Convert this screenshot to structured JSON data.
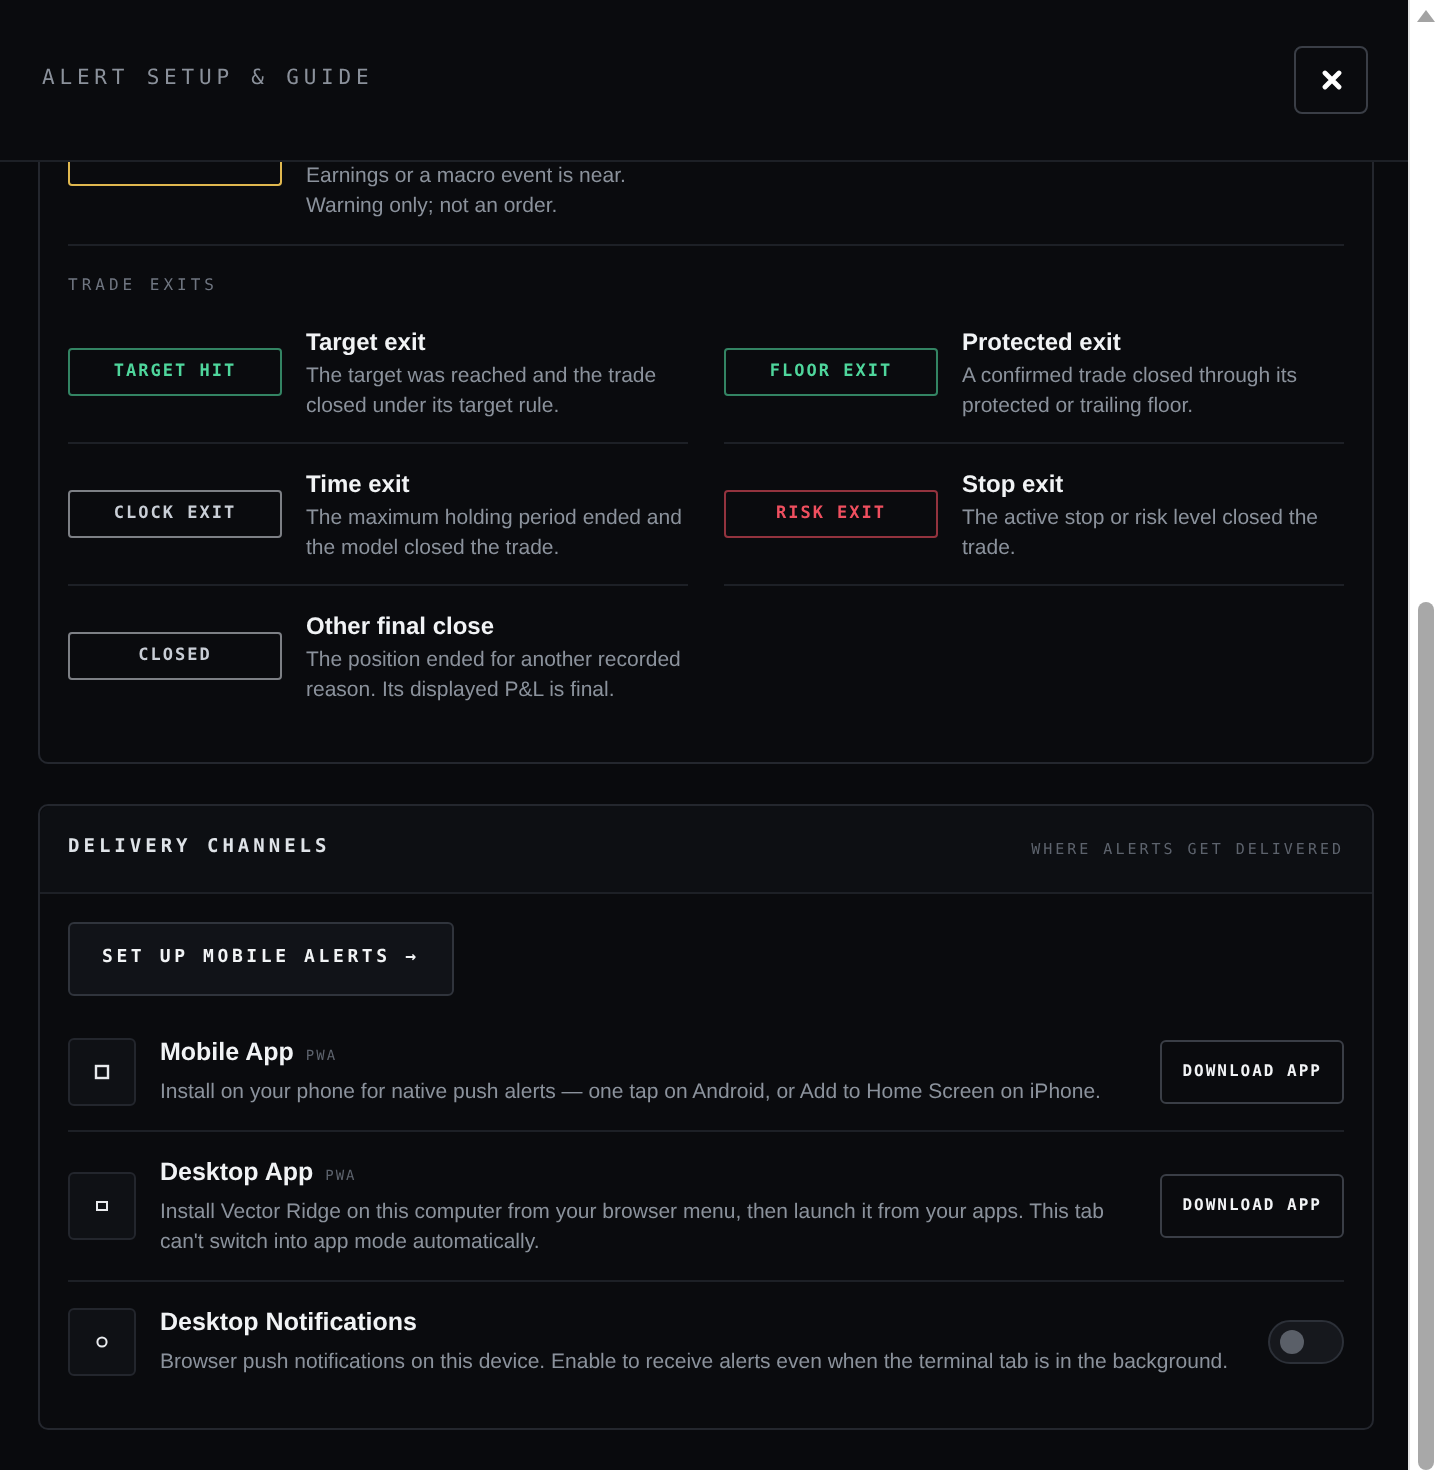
{
  "header": {
    "title": "ALERT SETUP & GUIDE"
  },
  "guide": {
    "partial_row": {
      "color": "#e0b84f",
      "lines": [
        "Earnings or a macro event is near.",
        "Warning only; not an order."
      ]
    },
    "section_label": "TRADE EXITS",
    "exits": [
      {
        "badge": "TARGET HIT",
        "color": "#4fd69c",
        "title": "Target exit",
        "description": "The target was reached and the trade closed under its target rule."
      },
      {
        "badge": "FLOOR EXIT",
        "color": "#4fd69c",
        "title": "Protected exit",
        "description": "A confirmed trade closed through its protected or trailing floor."
      },
      {
        "badge": "CLOCK EXIT",
        "color": "#c9ced6",
        "title": "Time exit",
        "description": "The maximum holding period ended and the model closed the trade."
      },
      {
        "badge": "RISK EXIT",
        "color": "#ef4f5f",
        "title": "Stop exit",
        "description": "The active stop or risk level closed the trade."
      },
      {
        "badge": "CLOSED",
        "color": "#c9ced6",
        "title": "Other final close",
        "description": "The position ended for another recorded reason. Its displayed P&L is final."
      }
    ]
  },
  "delivery": {
    "title": "DELIVERY CHANNELS",
    "subtitle": "WHERE ALERTS GET DELIVERED",
    "setup_button": "SET UP MOBILE ALERTS →",
    "channels": [
      {
        "kind": "download",
        "title": "Mobile App",
        "tag": "PWA",
        "description": "Install on your phone for native push alerts — one tap on Android, or Add to Home Screen on iPhone.",
        "button": "DOWNLOAD APP"
      },
      {
        "kind": "download",
        "title": "Desktop App",
        "tag": "PWA",
        "description": "Install Vector Ridge on this computer from your browser menu, then launch it from your apps. This tab can't switch into app mode automatically.",
        "button": "DOWNLOAD APP"
      },
      {
        "kind": "toggle",
        "title": "Desktop Notifications",
        "description": "Browser push notifications on this device. Enable to receive alerts even when the terminal tab is in the background.",
        "on": false
      }
    ]
  }
}
